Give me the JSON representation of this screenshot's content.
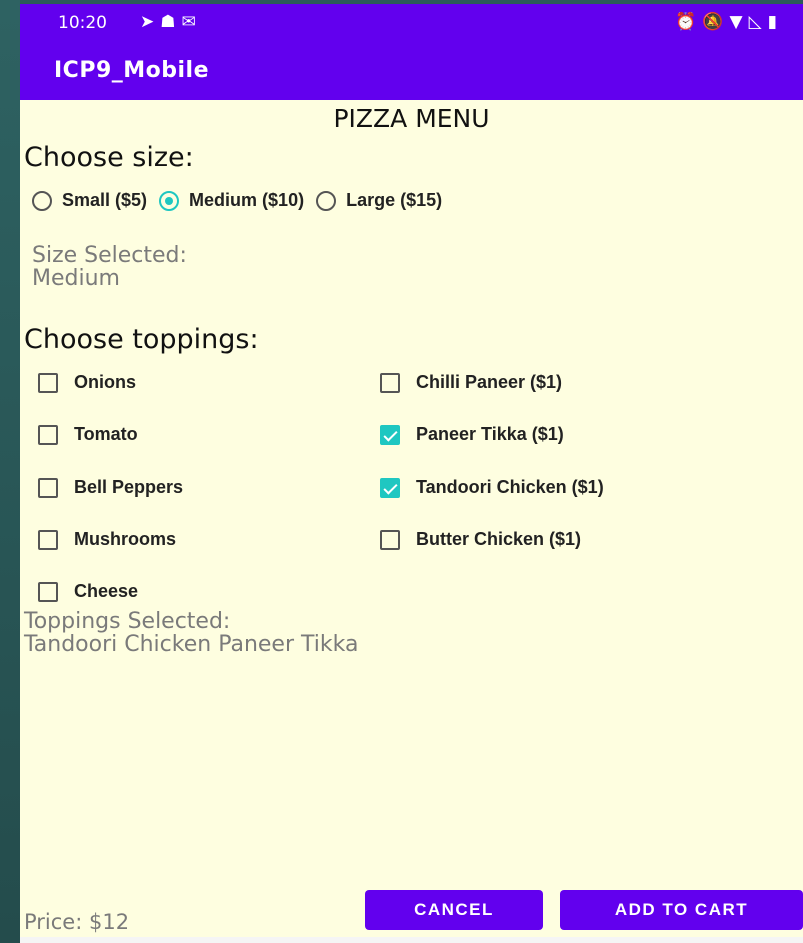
{
  "status_bar": {
    "time": "10:20",
    "left_icons": [
      "telegram-icon",
      "snapchat-icon",
      "gmail-icon"
    ],
    "right_icons": [
      "alarm-icon",
      "mute-icon",
      "wifi-icon",
      "signal-icon",
      "battery-icon"
    ]
  },
  "app_bar": {
    "title": "ICP9_Mobile"
  },
  "menu": {
    "title": "PIZZA MENU",
    "size_heading": "Choose size:",
    "sizes": [
      {
        "label": "Small ($5)",
        "checked": false
      },
      {
        "label": "Medium ($10)",
        "checked": true
      },
      {
        "label": "Large ($15)",
        "checked": false
      }
    ],
    "size_selected_label": "Size Selected:",
    "size_selected_value": "Medium",
    "toppings_heading": "Choose toppings:",
    "toppings_left": [
      {
        "label": "Onions",
        "checked": false
      },
      {
        "label": "Tomato",
        "checked": false
      },
      {
        "label": "Bell Peppers",
        "checked": false
      },
      {
        "label": "Mushrooms",
        "checked": false
      },
      {
        "label": "Cheese",
        "checked": false
      }
    ],
    "toppings_right": [
      {
        "label": "Chilli Paneer ($1)",
        "checked": false
      },
      {
        "label": "Paneer Tikka ($1)",
        "checked": true
      },
      {
        "label": "Tandoori Chicken ($1)",
        "checked": true
      },
      {
        "label": "Butter Chicken ($1)",
        "checked": false
      }
    ],
    "toppings_selected_label": "Toppings Selected:",
    "toppings_selected_value": "Tandoori Chicken Paneer Tikka",
    "price": "Price: $12",
    "cancel_label": "CANCEL",
    "add_to_cart_label": "ADD TO CART"
  },
  "colors": {
    "accent": "#6200ee",
    "check": "#1fc7c1",
    "background": "#fefee0"
  }
}
